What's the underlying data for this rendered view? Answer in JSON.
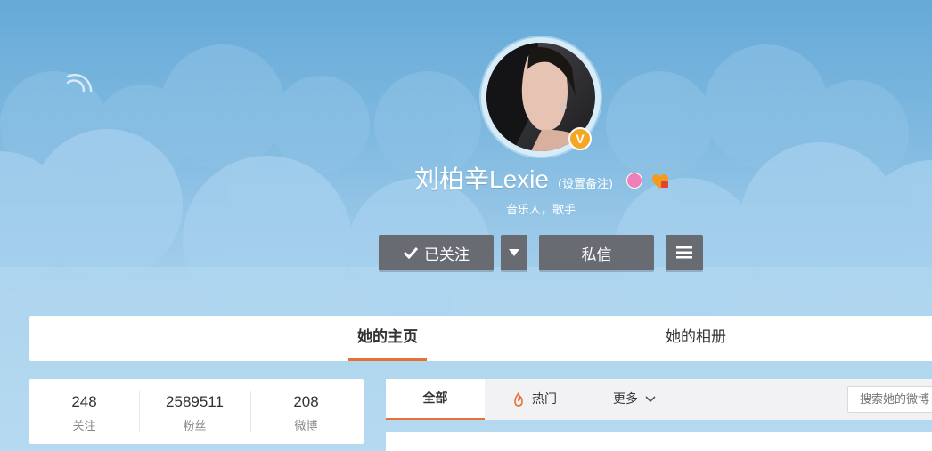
{
  "profile": {
    "name": "刘柏辛Lexie",
    "remark_link": "(设置备注)",
    "bio": "音乐人，歌手",
    "verified_badge": "V"
  },
  "actions": {
    "follow_label": "已关注",
    "message_label": "私信"
  },
  "icons": {
    "follow": "check-icon",
    "dropdown": "caret-down-icon",
    "menu": "hamburger-icon",
    "hot": "flame-icon",
    "more": "chevron-down-icon",
    "signal": "signal-icon"
  },
  "main_tabs": [
    {
      "label": "她的主页",
      "active": true
    },
    {
      "label": "她的相册",
      "active": false
    }
  ],
  "stats": [
    {
      "value": "248",
      "label": "关注"
    },
    {
      "value": "2589511",
      "label": "粉丝"
    },
    {
      "value": "208",
      "label": "微博"
    }
  ],
  "feed_tabs": {
    "all": "全部",
    "hot": "热门",
    "more": "更多"
  },
  "search": {
    "placeholder": "搜索她的微博"
  },
  "colors": {
    "accent": "#e57234",
    "button": "#686b72",
    "verified": "#f5a623"
  }
}
